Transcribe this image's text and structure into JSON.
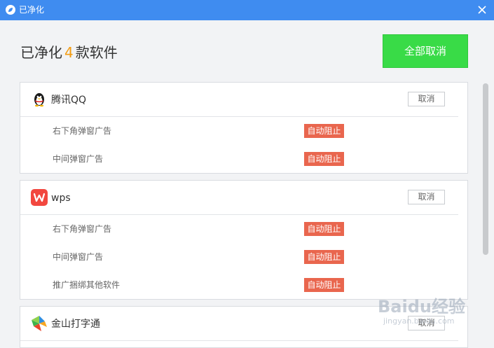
{
  "window": {
    "title": "已净化"
  },
  "header": {
    "summary_prefix": "已净化",
    "summary_count": "4",
    "summary_suffix": "款软件",
    "cancel_all_label": "全部取消"
  },
  "apps": [
    {
      "name": "腾讯QQ",
      "icon": "qq-penguin-icon",
      "cancel_label": "取消",
      "rules": [
        {
          "label": "右下角弹窗广告",
          "status": "自动阻止"
        },
        {
          "label": "中间弹窗广告",
          "status": "自动阻止"
        }
      ]
    },
    {
      "name": "wps",
      "icon": "wps-icon",
      "cancel_label": "取消",
      "rules": [
        {
          "label": "右下角弹窗广告",
          "status": "自动阻止"
        },
        {
          "label": "中间弹窗广告",
          "status": "自动阻止"
        },
        {
          "label": "推广捆绑其他软件",
          "status": "自动阻止"
        }
      ]
    },
    {
      "name": "金山打字通",
      "icon": "jinshan-typing-icon",
      "cancel_label": "取消",
      "rules": []
    }
  ],
  "watermark": {
    "brand": "Baidu经验",
    "url": "jingyan.baidu.com"
  },
  "colors": {
    "titlebar": "#3f8cf0",
    "accent_count": "#f39c12",
    "cancel_all_bg": "#39db47",
    "badge_bg": "#e9664e"
  }
}
